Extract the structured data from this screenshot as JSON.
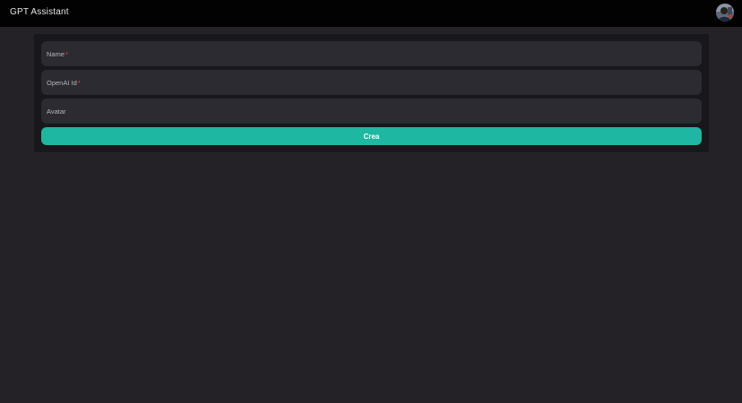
{
  "header": {
    "app_title": "GPT Assistant",
    "avatar_icon": "user-avatar-photo"
  },
  "form": {
    "fields": [
      {
        "label": "Name",
        "required": true,
        "required_mark": "*",
        "value": ""
      },
      {
        "label": "OpenAI Id",
        "required": true,
        "required_mark": "*",
        "value": ""
      },
      {
        "label": "Avatar",
        "required": false,
        "value": ""
      }
    ],
    "submit_label": "Crea"
  },
  "colors": {
    "background": "#242227",
    "topbar": "#020202",
    "panel": "#18171b",
    "field": "#2c2b31",
    "accent": "#1eb8a2",
    "required": "#ef4444"
  }
}
